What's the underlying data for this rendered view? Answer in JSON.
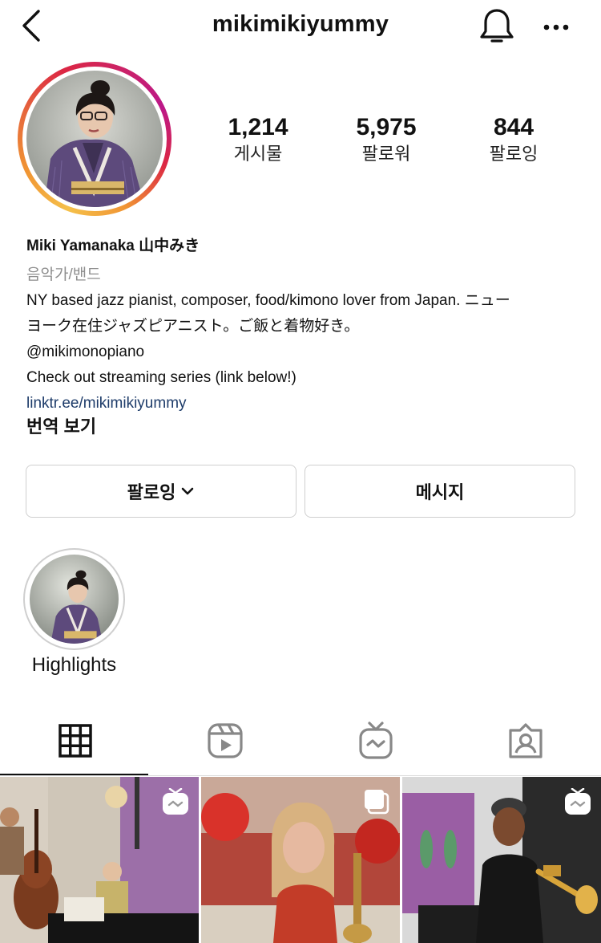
{
  "header": {
    "username": "mikimikiyummy",
    "back_icon": "chevron-left-icon",
    "notify_icon": "bell-icon",
    "more_icon": "more-horizontal-icon"
  },
  "profile": {
    "stats": [
      {
        "value": "1,214",
        "label": "게시물"
      },
      {
        "value": "5,975",
        "label": "팔로워"
      },
      {
        "value": "844",
        "label": "팔로잉"
      }
    ],
    "name": "Miki Yamanaka 山中みき",
    "category": "음악가/밴드",
    "bio_lines": [
      "NY based jazz pianist, composer, food/kimono lover from Japan. ニュー",
      "ヨーク在住ジャズピアニスト。ご飯と着物好き。",
      "@mikimonopiano",
      "Check out streaming series (link below!)"
    ],
    "link": "linktr.ee/mikimikiyummy",
    "translate": "번역 보기",
    "avatar_ring_colors": [
      "#f09433",
      "#dc2743",
      "#bc1888"
    ]
  },
  "actions": {
    "following_label": "팔로잉",
    "message_label": "메시지"
  },
  "highlights": [
    {
      "label": "Highlights"
    }
  ],
  "tabs": [
    {
      "name": "grid",
      "icon": "grid-icon",
      "active": true
    },
    {
      "name": "reels",
      "icon": "reels-icon",
      "active": false
    },
    {
      "name": "igtv",
      "icon": "igtv-icon",
      "active": false
    },
    {
      "name": "tagged",
      "icon": "tagged-icon",
      "active": false
    }
  ],
  "posts": [
    {
      "type": "igtv",
      "badge_icon": "igtv-badge-icon"
    },
    {
      "type": "album",
      "badge_icon": "album-badge-icon"
    },
    {
      "type": "igtv",
      "badge_icon": "igtv-badge-icon"
    }
  ]
}
